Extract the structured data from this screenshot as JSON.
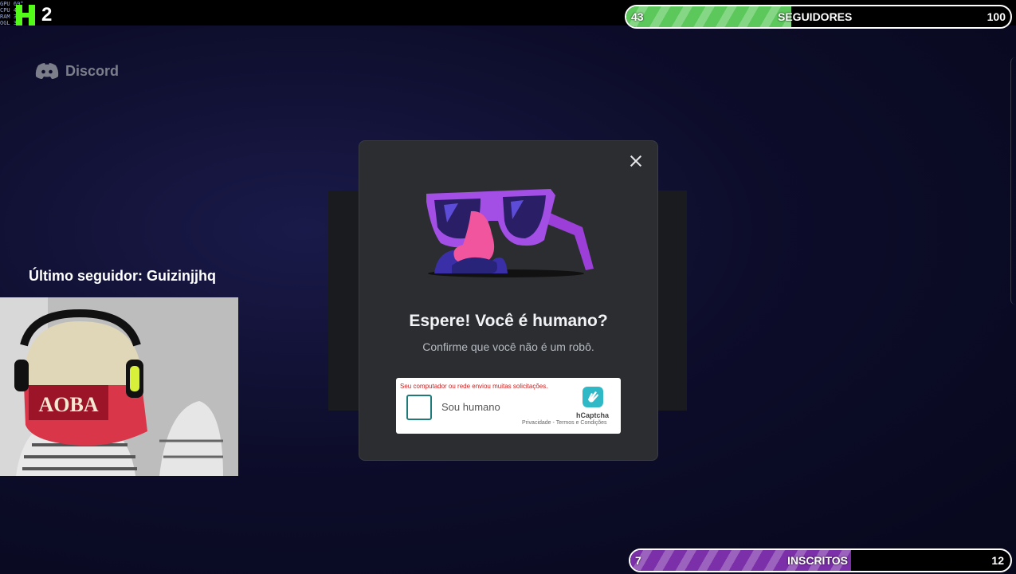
{
  "overlay": {
    "stats_lines": [
      "GPU  69°",
      "CPU  44°",
      "RAM  35°",
      "OGL  30 FPS"
    ],
    "kick_number": "2"
  },
  "followers_bar": {
    "current": "43",
    "label": "SEGUIDORES",
    "goal": "100",
    "progress": 0.43,
    "fill_color": "#5cc85c"
  },
  "subs_bar": {
    "current": "7",
    "label": "INSCRITOS",
    "goal": "12",
    "progress": 0.58,
    "fill_color": "#7b2fa8"
  },
  "discord": {
    "brand": "Discord",
    "icon": "discord-logo-icon"
  },
  "last_follower": "Último seguidor: Guizinjjhq",
  "webcam": {
    "cap_text": "AOBA"
  },
  "modal": {
    "title": "Espere! Você é humano?",
    "subtitle": "Confirme que você não é um robô.",
    "close_icon": "close-icon",
    "illustration": "disguise-glasses-icon"
  },
  "captcha": {
    "error": "Seu computador ou rede enviou muitas solicitações.",
    "checkbox_label": "Sou humano",
    "brand": "hCaptcha",
    "link_privacy": "Privacidade",
    "separator": " - ",
    "link_terms": "Termos e Condições"
  },
  "colors": {
    "modal_bg": "#2b2d31",
    "accent_green": "#53fc18"
  }
}
